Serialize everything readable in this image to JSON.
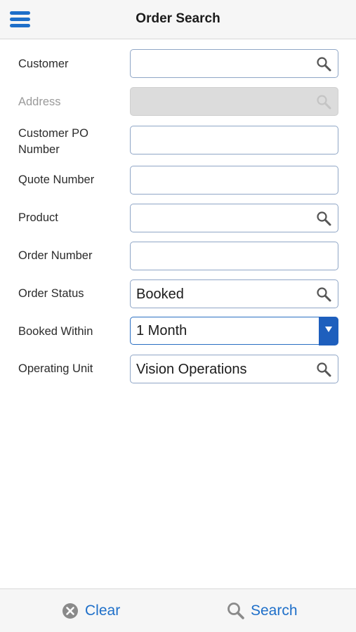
{
  "header": {
    "title": "Order Search",
    "menu_icon": "hamburger-menu-icon"
  },
  "form": {
    "customer": {
      "label": "Customer",
      "value": ""
    },
    "address": {
      "label": "Address",
      "value": ""
    },
    "customer_po": {
      "label_line1": "Customer PO",
      "label_line2": "Number",
      "value": ""
    },
    "quote_number": {
      "label": "Quote Number",
      "value": ""
    },
    "product": {
      "label": "Product",
      "value": ""
    },
    "order_number": {
      "label": "Order Number",
      "value": ""
    },
    "order_status": {
      "label": "Order Status",
      "value": "Booked"
    },
    "booked_within": {
      "label": "Booked Within",
      "value": "1 Month"
    },
    "operating_unit": {
      "label": "Operating Unit",
      "value": "Vision Operations"
    }
  },
  "footer": {
    "clear_label": "Clear",
    "search_label": "Search"
  },
  "colors": {
    "accent": "#1e6fc9",
    "dropdown": "#1e5fbd",
    "disabled_field": "#dcdcdc"
  }
}
